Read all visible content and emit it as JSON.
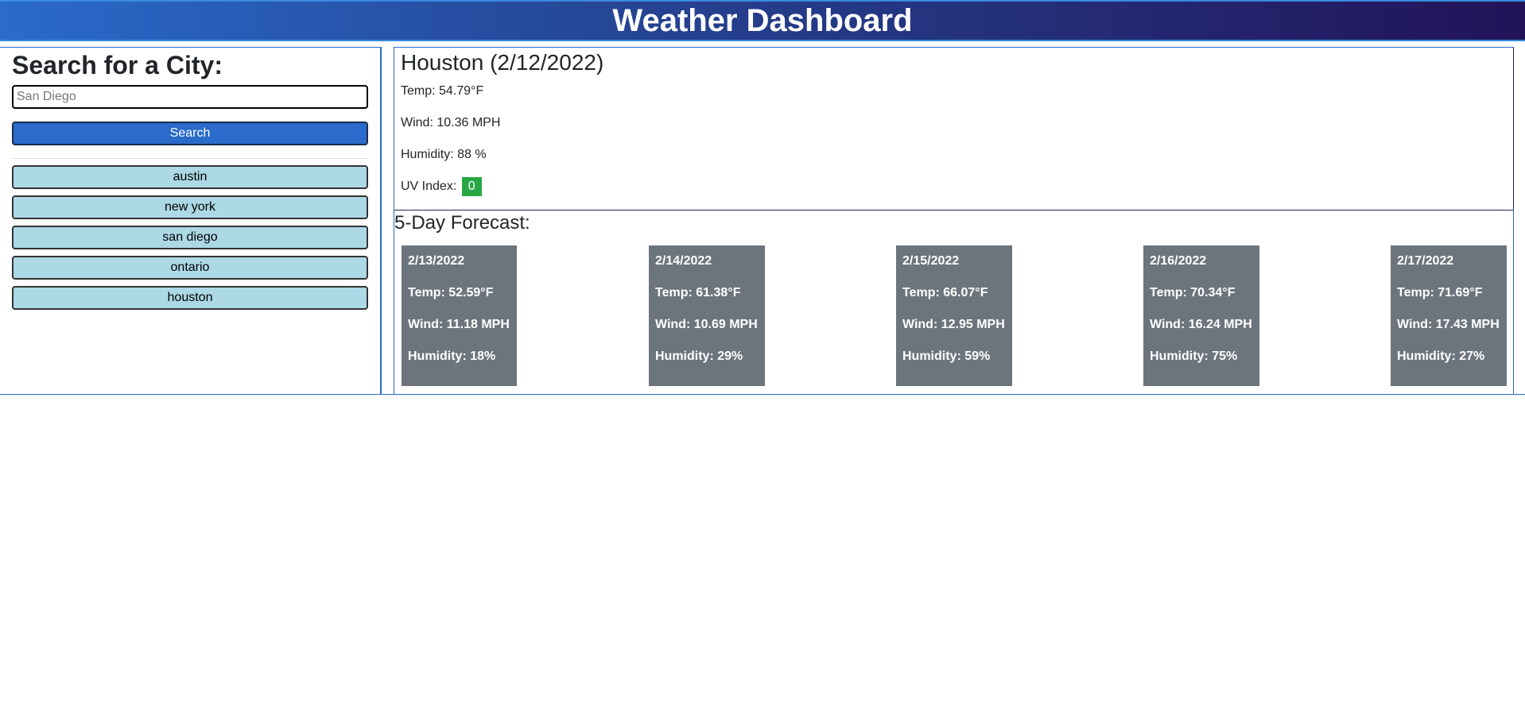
{
  "header": {
    "title": "Weather Dashboard"
  },
  "search": {
    "heading": "Search for a City:",
    "placeholder": "San Diego",
    "button_label": "Search"
  },
  "history": [
    {
      "label": "austin"
    },
    {
      "label": "new york"
    },
    {
      "label": "san diego"
    },
    {
      "label": "ontario"
    },
    {
      "label": "houston"
    }
  ],
  "current": {
    "title": "Houston (2/12/2022)",
    "temp": "Temp: 54.79°F",
    "wind": "Wind: 10.36 MPH",
    "humidity": "Humidity: 88 %",
    "uv_label": "UV Index:",
    "uv_value": "0",
    "uv_color": "#28a745"
  },
  "forecast": {
    "heading": "5-Day Forecast:",
    "days": [
      {
        "date": "2/13/2022",
        "temp": "Temp: 52.59°F",
        "wind": "Wind: 11.18 MPH",
        "humidity": "Humidity: 18%"
      },
      {
        "date": "2/14/2022",
        "temp": "Temp: 61.38°F",
        "wind": "Wind: 10.69 MPH",
        "humidity": "Humidity: 29%"
      },
      {
        "date": "2/15/2022",
        "temp": "Temp: 66.07°F",
        "wind": "Wind: 12.95 MPH",
        "humidity": "Humidity: 59%"
      },
      {
        "date": "2/16/2022",
        "temp": "Temp: 70.34°F",
        "wind": "Wind: 16.24 MPH",
        "humidity": "Humidity: 75%"
      },
      {
        "date": "2/17/2022",
        "temp": "Temp: 71.69°F",
        "wind": "Wind: 17.43 MPH",
        "humidity": "Humidity: 27%"
      }
    ]
  },
  "colors": {
    "accent": "#2a6bcb",
    "history_button": "#add8e6",
    "card": "#6c757d"
  }
}
